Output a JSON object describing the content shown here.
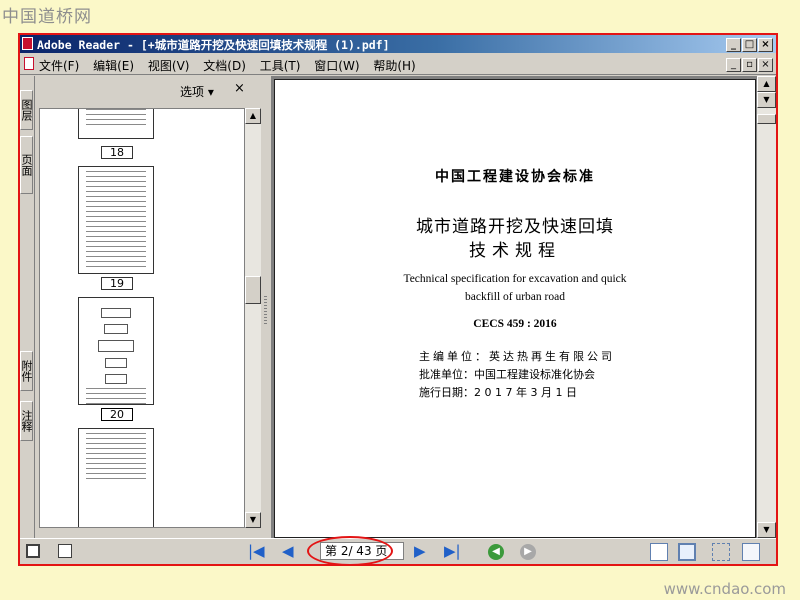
{
  "watermarks": {
    "top": "中国道桥网",
    "bottom": "www.cndao.com"
  },
  "window": {
    "title": "Adobe Reader - [+城市道路开挖及快速回填技术规程 (1).pdf]",
    "controls": [
      "_",
      "□",
      "×"
    ]
  },
  "menu": {
    "items": [
      "文件(F)",
      "编辑(E)",
      "视图(V)",
      "文档(D)",
      "工具(T)",
      "窗口(W)",
      "帮助(H)"
    ],
    "doc_controls": [
      "_",
      "▫",
      "×"
    ]
  },
  "side_tabs": [
    "图层",
    "页面",
    "附件",
    "注释"
  ],
  "nav_panel": {
    "options_label": "选项 ▾",
    "close_label": "×",
    "thumbnails": [
      {
        "label": "18"
      },
      {
        "label": "19"
      },
      {
        "label": "20"
      },
      {
        "label": ""
      }
    ]
  },
  "page": {
    "standard": "中国工程建设协会标准",
    "title_line1": "城市道路开挖及快速回填",
    "title_line2": "技术规程",
    "english_line1": "Technical specification for excavation and quick",
    "english_line2": "backfill of urban road",
    "code": "CECS 459 : 2016",
    "editor": "主编单位：英达热再生有限公司",
    "approver": "批准单位：中国工程建设标准化协会",
    "date": "施行日期：2 0 1 7 年 3 月 1 日"
  },
  "status": {
    "page_display": "第 2/ 43 页",
    "current_page": 2,
    "total_pages": 43
  },
  "colors": {
    "highlight": "#e31414",
    "title_bar": "#0a246a",
    "background": "#fbf8c8"
  }
}
